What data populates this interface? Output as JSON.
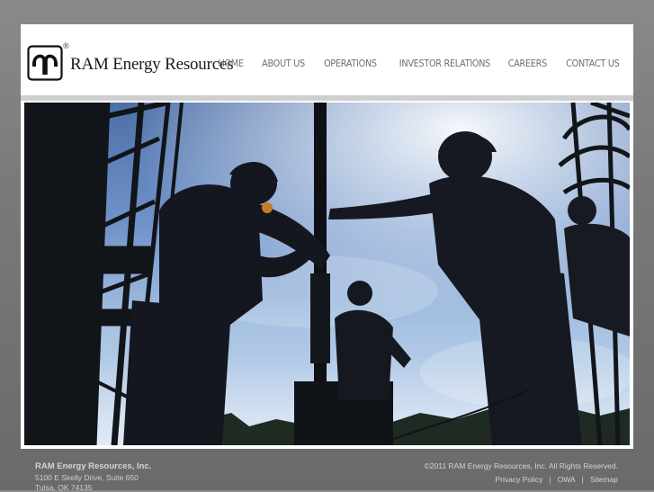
{
  "brand": {
    "name": "RAM Energy Resources",
    "registered": "®",
    "logo_icon": "ram-logo-icon"
  },
  "nav": {
    "items": [
      {
        "label": "HOME"
      },
      {
        "label": "ABOUT US"
      },
      {
        "label": "OPERATIONS"
      },
      {
        "label": "INVESTOR RELATIONS"
      },
      {
        "label": "CAREERS"
      },
      {
        "label": "CONTACT US"
      }
    ]
  },
  "hero": {
    "image_icon": "oil-rig-workers-photo"
  },
  "footer": {
    "company": "RAM Energy Resources, Inc.",
    "address_line1": "5100 E Skelly Drive, Suite 650",
    "address_line2": "Tulsa, OK 74135",
    "copyright": "©2011 RAM Energy Resources, Inc. All Rights Reserved.",
    "links": [
      {
        "label": "Privacy Policy"
      },
      {
        "label": "OWA"
      },
      {
        "label": "Sitemap"
      }
    ]
  },
  "colors": {
    "background": "#7a7a7a",
    "nav_text": "#6e6e6e",
    "divider": "#cfcfcf",
    "sky": "#6f92c9",
    "silhouette": "#14171f"
  }
}
